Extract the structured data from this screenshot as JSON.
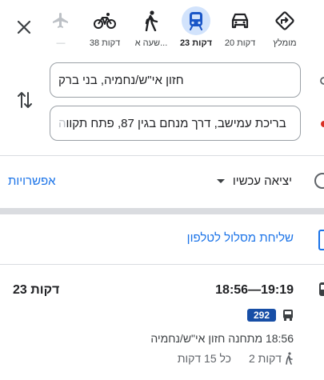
{
  "colors": {
    "accent": "#1a73e8",
    "active_mode_bg": "#d2e3fc",
    "line_badge": "#174ea6",
    "divider": "#dadce0"
  },
  "modes": [
    {
      "key": "recommended",
      "icon": "directions-icon",
      "label": "מומלץ"
    },
    {
      "key": "driving",
      "icon": "car-icon",
      "label": "20 דקות"
    },
    {
      "key": "transit",
      "icon": "train-icon",
      "label": "23 דקות",
      "active": true
    },
    {
      "key": "walking",
      "icon": "walk-icon",
      "label": "שעה א..."
    },
    {
      "key": "cycling",
      "icon": "bike-icon",
      "label": "38 דקות"
    },
    {
      "key": "flight",
      "icon": "plane-icon",
      "label": "—"
    }
  ],
  "origin": {
    "value": "חזון אי\"ש/נחמיה, בני ברק"
  },
  "destination": {
    "value": "בריכת עמישב, דרך מנחם בגין 87, פתח תקווה",
    "visible": "בריכת עמישב, דרך מנחם בגין 87, פתח תקוו",
    "faded": "ה"
  },
  "options": {
    "link": "אפשרויות",
    "depart": "יציאה עכשיו"
  },
  "send_to_phone": "שליחת מסלול לטלפון",
  "route": {
    "duration": "23 דקות",
    "times": "18:56—19:19",
    "line": "292",
    "stop": "18:56 מתחנה חזון אי\"ש/נחמיה",
    "walk": "2 דקות",
    "frequency": "כל 15 דקות"
  }
}
